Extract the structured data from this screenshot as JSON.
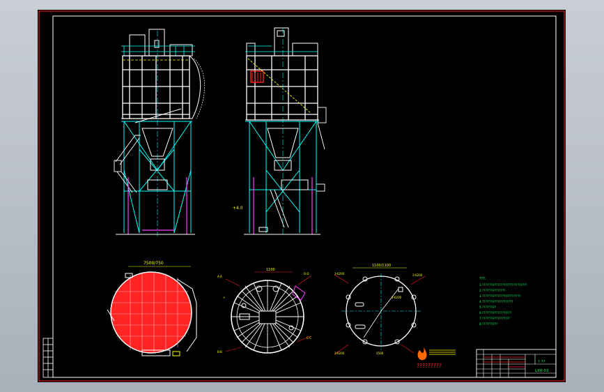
{
  "drawing": {
    "title_block": {
      "drawing_name": "? ??",
      "drawing_number": "LXR-03",
      "company_text": "?????????"
    },
    "notes_heading": "???:",
    "notes_lines": [
      "1.?????????????????????????????",
      "2.???????????????",
      "3.?????????????????????????",
      "4.????????????????????",
      "5.?????????",
      "6.???????????????????",
      "7.??????????????????",
      "8.??????????"
    ],
    "views": {
      "top_left_dimension": "7500/750",
      "top_right_dimension": "1100/1100",
      "section_dimension": "1100",
      "side_elevation_tag": "+4.0",
      "middle_tags": [
        "A-A",
        "B-B",
        "C-C",
        "D-D"
      ],
      "right_tags": [
        "3-6200",
        "3-6200",
        "3-6200",
        "3-6200",
        "2500"
      ]
    },
    "colors": {
      "frame_red": "#ff2020",
      "structure_white": "#ffffff",
      "stair_cyan": "#00ffff",
      "column_magenta": "#ff40ff",
      "hatch_red": "#ff2424",
      "note_green": "#00ff66",
      "hopper_yellow": "#ffff00"
    }
  }
}
